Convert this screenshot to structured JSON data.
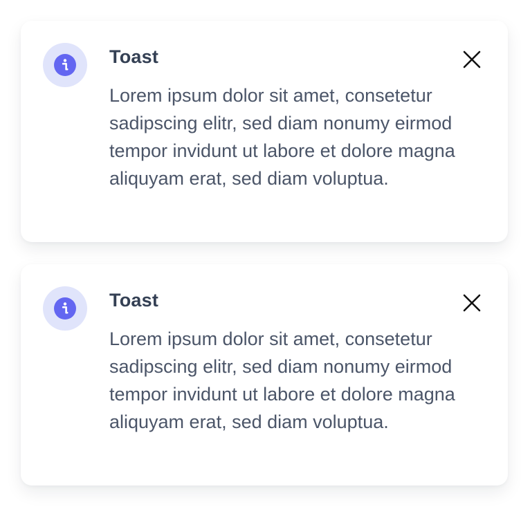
{
  "toasts": [
    {
      "title": "Toast",
      "message": "Lorem ipsum dolor sit amet, consetetur sadipscing elitr, sed diam nonumy eirmod tempor invidunt ut labore et dolore magna aliquyam erat, sed diam voluptua.",
      "icon": "info-icon",
      "close_icon": "close-icon"
    },
    {
      "title": "Toast",
      "message": "Lorem ipsum dolor sit amet, consetetur sadipscing elitr, sed diam nonumy eirmod tempor invidunt ut labore et dolore magna aliquyam erat, sed diam voluptua.",
      "icon": "info-icon",
      "close_icon": "close-icon"
    }
  ],
  "colors": {
    "accent": "#6366f1",
    "icon_bg": "#e0e4fb",
    "title": "#344054",
    "body": "#4b5568",
    "close": "#111111"
  }
}
